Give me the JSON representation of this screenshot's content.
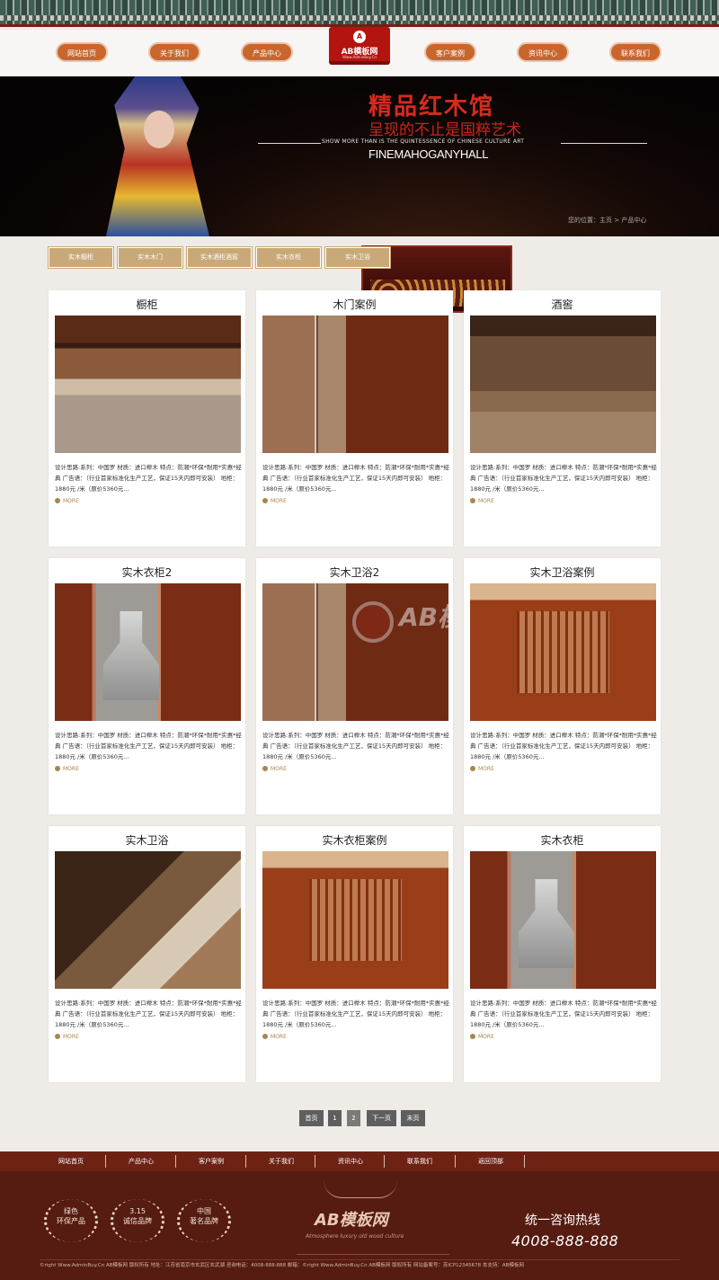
{
  "nav": {
    "items": [
      "网站首页",
      "关于我们",
      "产品中心",
      "客户案例",
      "资讯中心",
      "联系我们"
    ],
    "logo_name": "AB模板网",
    "logo_sub": "Www.AdminBuy.Cn"
  },
  "banner": {
    "title": "精品红木馆",
    "subtitle": "呈现的不止是国粹艺术",
    "en_line": "SHOW MORE THAN IS THE QUINTESSENCE OF CHINESE CULTURE ART",
    "en_name": "FINEMAHOGANYHALL",
    "breadcrumb": "您的位置：主页 > 产品中心"
  },
  "categories": [
    "实木橱柜",
    "实木木门",
    "实木酒柜酒窖",
    "实木衣柜",
    "实木卫浴"
  ],
  "products": [
    {
      "title": "橱柜",
      "desc": "设计思路:系列：中国罗 材质：进口榉木 特点：防潮*环保*耐用*实惠*经典 广告语：（行业首家标准化生产工艺，保证15天内即可安装） 地柜：1880元 /米（原价5360元...",
      "more": "MORE",
      "img": "kitchen"
    },
    {
      "title": "木门案例",
      "desc": "设计思路:系列：中国罗 材质：进口榉木 特点：防潮*环保*耐用*实惠*经典 广告语：（行业首家标准化生产工艺，保证15天内即可安装） 地柜：1880元 /米（原价5360元...",
      "more": "MORE",
      "img": "door"
    },
    {
      "title": "酒窖",
      "desc": "设计思路:系列：中国罗 材质：进口榉木 特点：防潮*环保*耐用*实惠*经典 广告语：（行业首家标准化生产工艺，保证15天内即可安装） 地柜：1880元 /米（原价5360元...",
      "more": "MORE",
      "img": "wine"
    },
    {
      "title": "实木衣柜2",
      "desc": "设计思路:系列：中国罗 材质：进口榉木 特点：防潮*环保*耐用*实惠*经典 广告语：（行业首家标准化生产工艺，保证15天内即可安装） 地柜：1880元 /米（原价5360元...",
      "more": "MORE",
      "img": "cabinet"
    },
    {
      "title": "实木卫浴2",
      "desc": "设计思路:系列：中国罗 材质：进口榉木 特点：防潮*环保*耐用*实惠*经典 广告语：（行业首家标准化生产工艺，保证15天内即可安装） 地柜：1880元 /米（原价5360元...",
      "more": "MORE",
      "img": "door"
    },
    {
      "title": "实木卫浴案例",
      "desc": "设计思路:系列：中国罗 材质：进口榉木 特点：防潮*环保*耐用*实惠*经典 广告语：（行业首家标准化生产工艺，保证15天内即可安装） 地柜：1880元 /米（原价5360元...",
      "more": "MORE",
      "img": "shelf"
    },
    {
      "title": "实木卫浴",
      "desc": "设计思路:系列：中国罗 材质：进口榉木 特点：防潮*环保*耐用*实惠*经典 广告语：（行业首家标准化生产工艺，保证15天内即可安装） 地柜：1880元 /米（原价5360元...",
      "more": "MORE",
      "img": "bath"
    },
    {
      "title": "实木衣柜案例",
      "desc": "设计思路:系列：中国罗 材质：进口榉木 特点：防潮*环保*耐用*实惠*经典 广告语：（行业首家标准化生产工艺，保证15天内即可安装） 地柜：1880元 /米（原价5360元...",
      "more": "MORE",
      "img": "shelf"
    },
    {
      "title": "实木衣柜",
      "desc": "设计思路:系列：中国罗 材质：进口榉木 特点：防潮*环保*耐用*实惠*经典 广告语：（行业首家标准化生产工艺，保证15天内即可安装） 地柜：1880元 /米（原价5360元...",
      "more": "MORE",
      "img": "cabinet"
    }
  ],
  "watermark": "AB模板网",
  "pagination": [
    "首页",
    "1",
    "2",
    "下一页",
    "末页"
  ],
  "footer_nav": [
    "网站首页",
    "产品中心",
    "客户案例",
    "关于我们",
    "资讯中心",
    "联系我们",
    "返回顶部"
  ],
  "footer": {
    "badges": [
      [
        "绿色",
        "环保产品"
      ],
      [
        "3.15",
        "诚信品牌"
      ],
      [
        "中国",
        "著名品牌"
      ]
    ],
    "logo": "AB模板网",
    "script": "Atmosphere luxury old wood culture",
    "hotline_label": "统一咨询热线",
    "hotline": "4008-888-888",
    "copyright": "©right Www.AdminBuy.Cn AB模板网 版权所有    地址：江苏省南京市玄武区玄武湖    咨询电话：4008-888-888    邮箱：©right Www.AdminBuy.Cn AB模板网 版权所有    网站备案号：苏ICP12345678  本支持：AB模板网"
  },
  "colors": {
    "nav_button": "#c8662c",
    "accent_red": "#b3140f",
    "category_button": "#c9a978",
    "footer_bg": "#561b11",
    "footer_nav_bg": "#6e2214"
  }
}
